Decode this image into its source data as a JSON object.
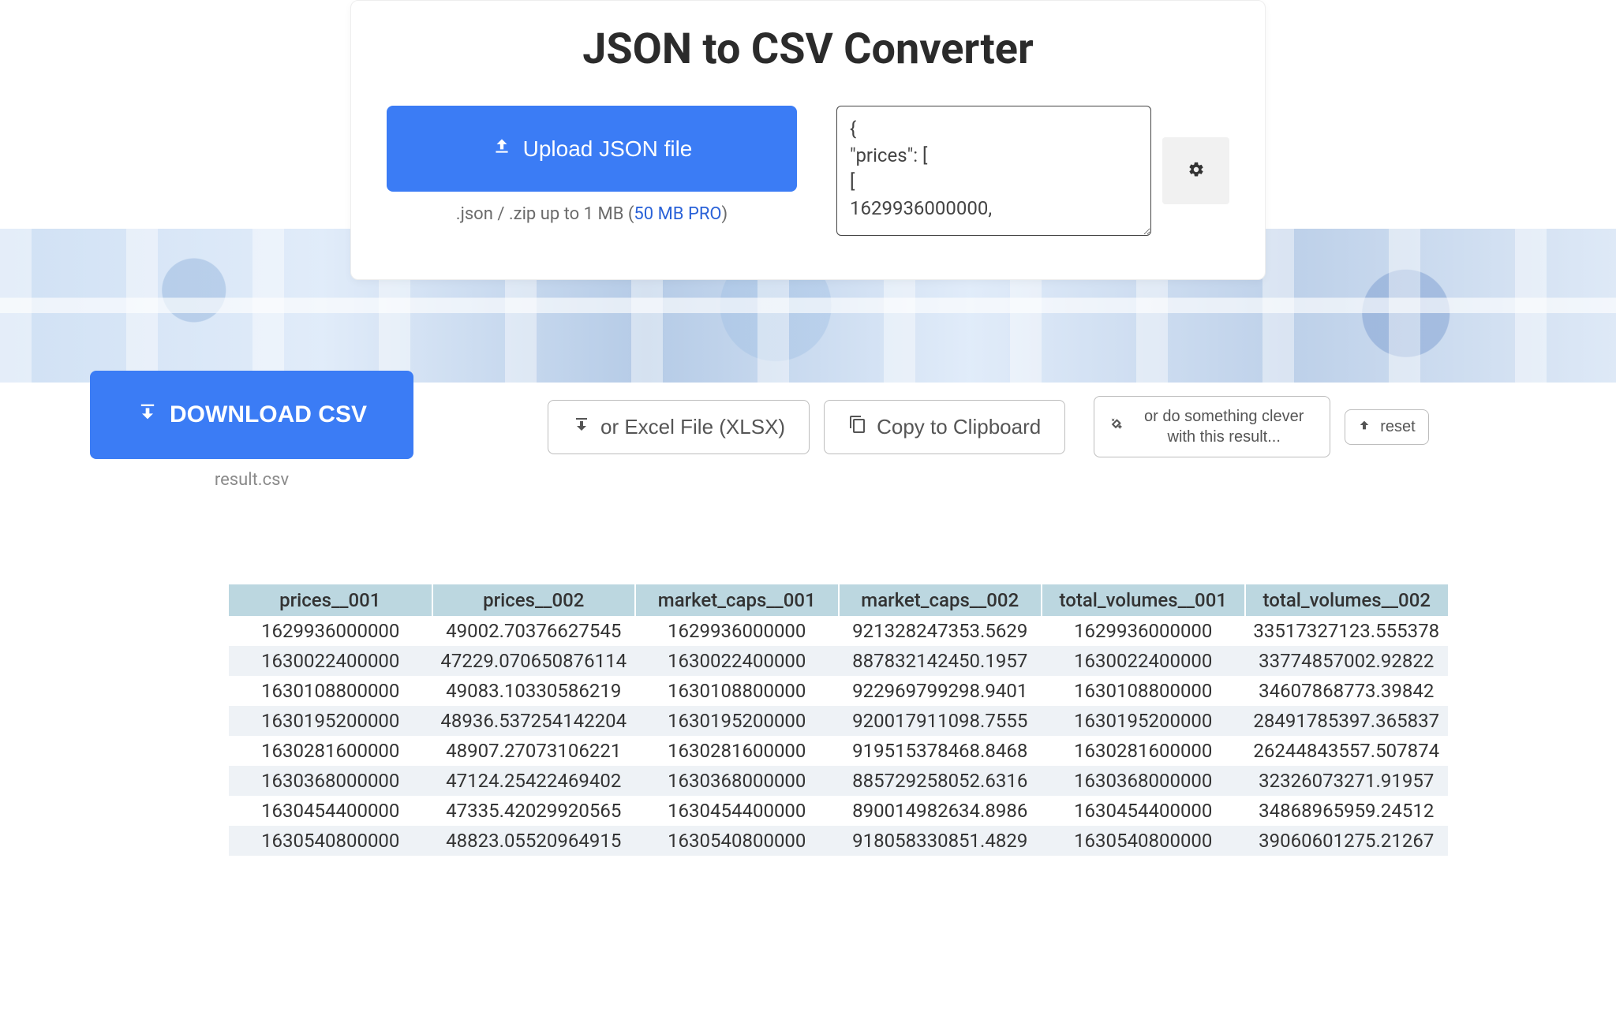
{
  "header": {
    "title": "JSON to CSV Converter"
  },
  "upload": {
    "button_label": "Upload JSON file",
    "hint_prefix": ".json / .zip up to 1 MB (",
    "hint_link": "50 MB PRO",
    "hint_suffix": ")"
  },
  "json_input": {
    "value": "{\n\"prices\": [\n[\n1629936000000,"
  },
  "actions": {
    "download_label": "DOWNLOAD CSV",
    "filename": "result.csv",
    "excel_label": "or Excel File (XLSX)",
    "clipboard_label": "Copy to Clipboard",
    "clever_label": "or do something clever with this result...",
    "reset_label": "reset"
  },
  "table": {
    "headers": [
      "prices__001",
      "prices__002",
      "market_caps__001",
      "market_caps__002",
      "total_volumes__001",
      "total_volumes__002"
    ],
    "rows": [
      [
        "1629936000000",
        "49002.70376627545",
        "1629936000000",
        "921328247353.5629",
        "1629936000000",
        "33517327123.555378"
      ],
      [
        "1630022400000",
        "47229.070650876114",
        "1630022400000",
        "887832142450.1957",
        "1630022400000",
        "33774857002.92822"
      ],
      [
        "1630108800000",
        "49083.10330586219",
        "1630108800000",
        "922969799298.9401",
        "1630108800000",
        "34607868773.39842"
      ],
      [
        "1630195200000",
        "48936.537254142204",
        "1630195200000",
        "920017911098.7555",
        "1630195200000",
        "28491785397.365837"
      ],
      [
        "1630281600000",
        "48907.27073106221",
        "1630281600000",
        "919515378468.8468",
        "1630281600000",
        "26244843557.507874"
      ],
      [
        "1630368000000",
        "47124.25422469402",
        "1630368000000",
        "885729258052.6316",
        "1630368000000",
        "32326073271.91957"
      ],
      [
        "1630454400000",
        "47335.42029920565",
        "1630454400000",
        "890014982634.8986",
        "1630454400000",
        "34868965959.24512"
      ],
      [
        "1630540800000",
        "48823.05520964915",
        "1630540800000",
        "918058330851.4829",
        "1630540800000",
        "39060601275.21267"
      ]
    ]
  }
}
